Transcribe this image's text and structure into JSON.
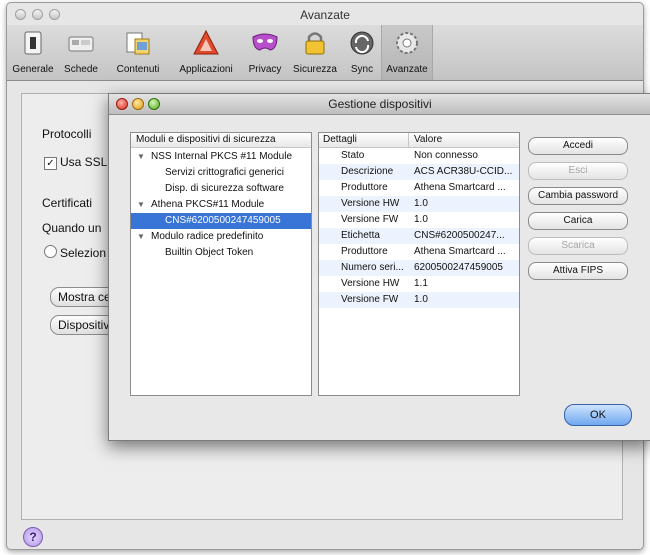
{
  "window": {
    "title": "Avanzate",
    "toolbar": [
      {
        "label": "Generale",
        "icon": "general-switch-icon"
      },
      {
        "label": "Schede",
        "icon": "tabs-icon"
      },
      {
        "label": "Contenuti",
        "icon": "content-icon"
      },
      {
        "label": "Applicazioni",
        "icon": "applications-icon"
      },
      {
        "label": "Privacy",
        "icon": "privacy-mask-icon"
      },
      {
        "label": "Sicurezza",
        "icon": "security-lock-icon"
      },
      {
        "label": "Sync",
        "icon": "sync-icon"
      },
      {
        "label": "Avanzate",
        "icon": "advanced-gear-icon"
      }
    ],
    "selected_tab": "Avanzate"
  },
  "background_pane": {
    "section_protocolli": "Protocolli",
    "usa_ssl": "Usa SSL",
    "section_certificati": "Certificati",
    "quando_un": "Quando un",
    "selezion": "Selezion",
    "mostra_btn": "Mostra ce",
    "dispositivi_btn": "Dispositiv"
  },
  "dialog": {
    "title": "Gestione dispositivi",
    "tree_header": "Moduli e dispositivi di sicurezza",
    "tree": [
      {
        "label": "NSS Internal PKCS #11 Module",
        "level": 0,
        "expanded": true,
        "selected": false
      },
      {
        "label": "Servizi crittografici generici",
        "level": 1,
        "expanded": false,
        "selected": false
      },
      {
        "label": "Disp. di sicurezza software",
        "level": 1,
        "expanded": false,
        "selected": false
      },
      {
        "label": "Athena PKCS#11 Module",
        "level": 0,
        "expanded": true,
        "selected": false
      },
      {
        "label": "CNS#6200500247459005",
        "level": 1,
        "expanded": false,
        "selected": true
      },
      {
        "label": "Modulo radice predefinito",
        "level": 0,
        "expanded": true,
        "selected": false
      },
      {
        "label": "Builtin Object Token",
        "level": 1,
        "expanded": false,
        "selected": false
      }
    ],
    "details_header": {
      "key": "Dettagli",
      "value": "Valore"
    },
    "details": [
      {
        "key": "Stato",
        "value": "Non connesso"
      },
      {
        "key": "Descrizione",
        "value": "ACS ACR38U-CCID..."
      },
      {
        "key": "Produttore",
        "value": "Athena Smartcard ..."
      },
      {
        "key": "Versione HW",
        "value": "1.0"
      },
      {
        "key": "Versione FW",
        "value": "1.0"
      },
      {
        "key": "Etichetta",
        "value": "CNS#6200500247..."
      },
      {
        "key": "Produttore",
        "value": "Athena Smartcard ..."
      },
      {
        "key": "Numero seri...",
        "value": "6200500247459005"
      },
      {
        "key": "Versione HW",
        "value": "1.1"
      },
      {
        "key": "Versione FW",
        "value": "1.0"
      }
    ],
    "buttons": [
      {
        "label": "Accedi",
        "enabled": true
      },
      {
        "label": "Esci",
        "enabled": false
      },
      {
        "label": "Cambia password",
        "enabled": true
      },
      {
        "label": "Carica",
        "enabled": true
      },
      {
        "label": "Scarica",
        "enabled": false
      },
      {
        "label": "Attiva FIPS",
        "enabled": true
      }
    ],
    "ok_label": "OK"
  },
  "help_label": "?"
}
